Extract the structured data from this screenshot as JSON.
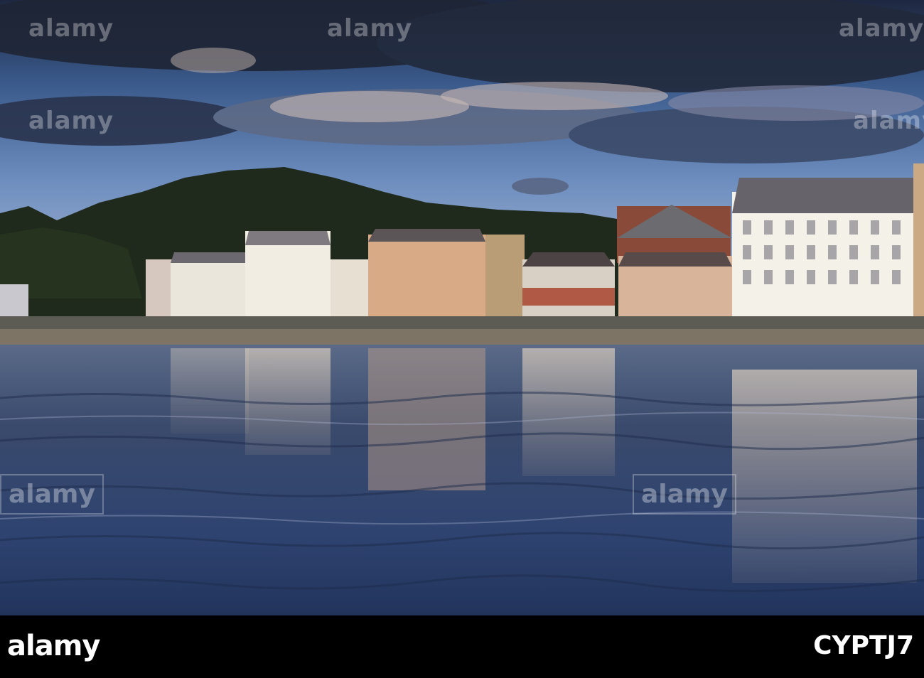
{
  "watermark": {
    "text": "alamy"
  },
  "footer": {
    "logo": "alamy",
    "image_code": "CYPTJ7"
  },
  "colors": {
    "sky_dark": "#2b3a5c",
    "sky_blue": "#4f7ab8",
    "water": "#3a4f78",
    "footer_bg": "#000000"
  }
}
